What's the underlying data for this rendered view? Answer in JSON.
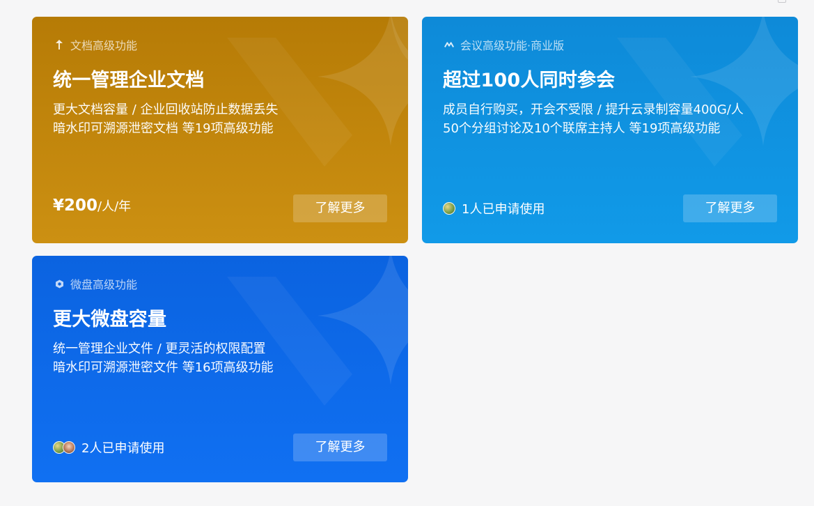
{
  "cards": [
    {
      "tag": "文档高级功能",
      "icon": "docs-icon",
      "title": "统一管理企业文档",
      "desc_lines": [
        "更大文档容量 / 企业回收站防止数据丢失",
        "暗水印可溯源泄密文档 等19项高级功能"
      ],
      "price_amount": "¥200",
      "price_unit": "/人/年",
      "button": "了解更多",
      "color": "#c18712"
    },
    {
      "tag": "会议高级功能·商业版",
      "icon": "meeting-icon",
      "title": "超过100人同时参会",
      "desc_lines": [
        "成员自行购买，开会不受限 / 提升云录制容量400G/人",
        "50个分组讨论及10个联席主持人 等19项高级功能"
      ],
      "applicants": "1人已申请使用",
      "button": "了解更多",
      "color": "#1093e2"
    },
    {
      "tag": "微盘高级功能",
      "icon": "drive-icon",
      "title": "更大微盘容量",
      "desc_lines": [
        "统一管理企业文件 / 更灵活的权限配置",
        "暗水印可溯源泄密文件 等16项高级功能"
      ],
      "applicants": "2人已申请使用",
      "button": "了解更多",
      "color": "#0d6bea"
    }
  ]
}
